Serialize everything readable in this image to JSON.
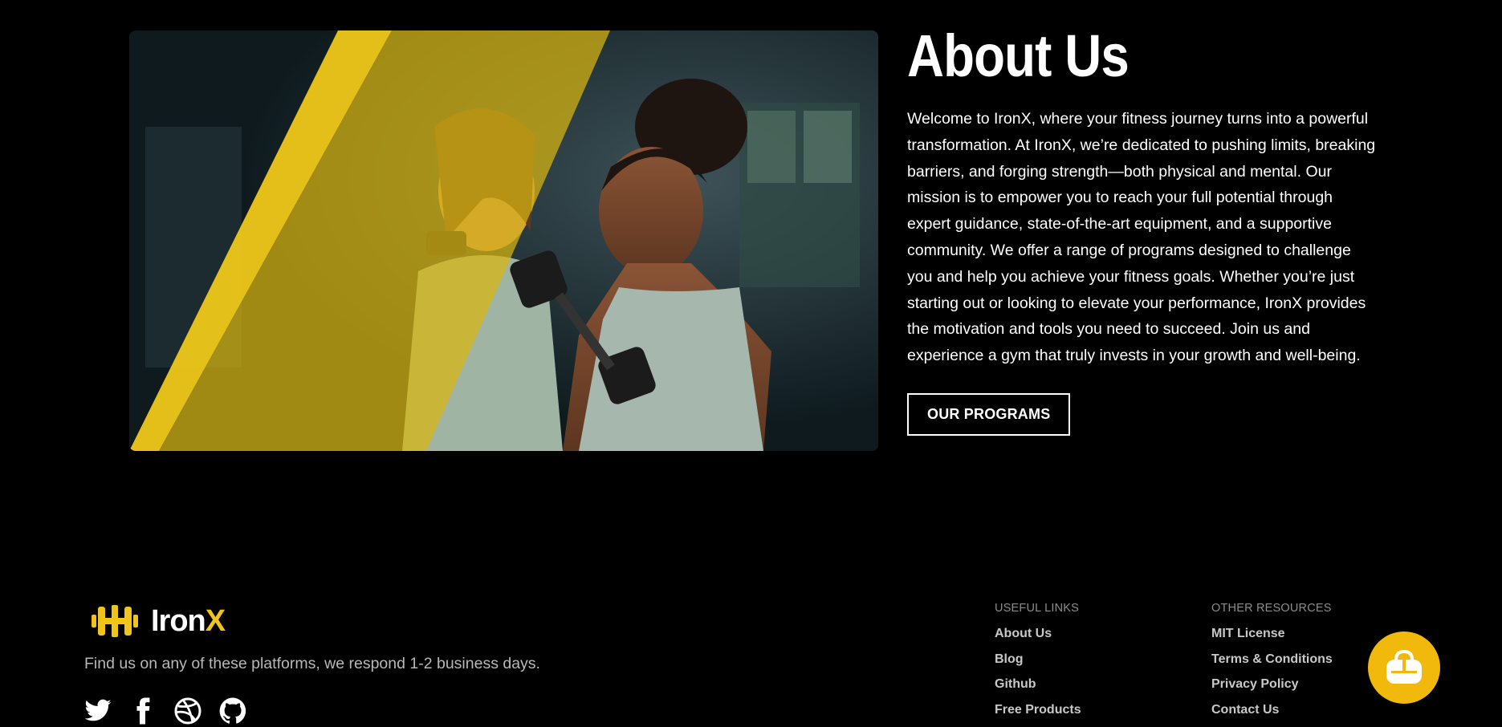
{
  "about": {
    "title": "About Us",
    "body": "Welcome to IronX, where your fitness journey turns into a powerful transformation. At IronX, we’re dedicated to pushing limits, breaking barriers, and forging strength—both physical and mental. Our mission is to empower you to reach your full potential through expert guidance, state-of-the-art equipment, and a supportive community. We offer a range of programs designed to challenge you and help you achieve your fitness goals. Whether you’re just starting out or looking to elevate your performance, IronX provides the motivation and tools you need to succeed. Join us and experience a gym that truly invests in your growth and well-being.",
    "button_label": "OUR PROGRAMS"
  },
  "footer": {
    "brand": {
      "name_main": "Iron",
      "name_accent": "X"
    },
    "tagline": "Find us on any of these platforms, we respond 1-2 business days.",
    "social": [
      "twitter-icon",
      "facebook-icon",
      "dribbble-icon",
      "github-icon"
    ],
    "useful_links": {
      "heading": "USEFUL LINKS",
      "items": [
        "About Us",
        "Blog",
        "Github",
        "Free Products"
      ]
    },
    "other_resources": {
      "heading": "OTHER RESOURCES",
      "items": [
        "MIT License",
        "Terms & Conditions",
        "Privacy Policy",
        "Contact Us"
      ]
    }
  },
  "colors": {
    "background": "#000000",
    "accent": "#f0c419",
    "fab": "#f0b90b"
  }
}
